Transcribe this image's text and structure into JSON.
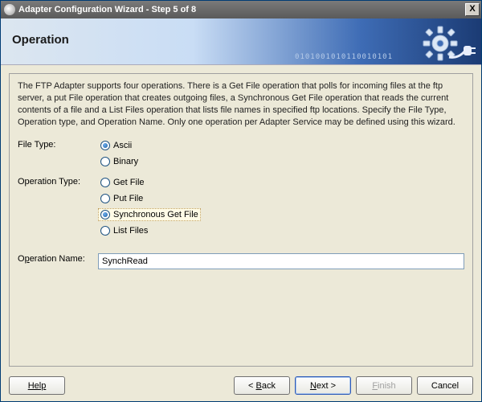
{
  "titlebar": {
    "title": "Adapter Configuration Wizard - Step 5 of 8",
    "close": "X"
  },
  "banner": {
    "heading": "Operation",
    "bits": "0101001010110010101"
  },
  "description": "The FTP Adapter supports four operations.  There is a Get File operation that polls for incoming files at the ftp server, a put File operation that creates outgoing files, a Synchronous Get File operation that reads the current contents of a file and a List Files operation that lists file names in specified ftp locations.  Specify the File Type, Operation type, and Operation Name.  Only one operation per Adapter Service may be defined using this wizard.",
  "labels": {
    "file_type": "File Type:",
    "operation_type": "Operation Type:",
    "operation_name_pre": "O",
    "operation_name_mn": "p",
    "operation_name_post": "eration Name:"
  },
  "file_type": {
    "options": [
      {
        "label": "Ascii",
        "selected": true
      },
      {
        "label": "Binary",
        "selected": false
      }
    ]
  },
  "operation_type": {
    "options": [
      {
        "label": "Get File",
        "selected": false
      },
      {
        "label": "Put File",
        "selected": false
      },
      {
        "label": "Synchronous Get File",
        "selected": true,
        "focused": true
      },
      {
        "label": "List Files",
        "selected": false
      }
    ]
  },
  "operation_name": {
    "value": "SynchRead"
  },
  "buttons": {
    "help": "Help",
    "back_pre": "< ",
    "back_mn": "B",
    "back_post": "ack",
    "next_mn": "N",
    "next_post": "ext >",
    "finish_mn": "F",
    "finish_post": "inish",
    "cancel": "Cancel"
  }
}
